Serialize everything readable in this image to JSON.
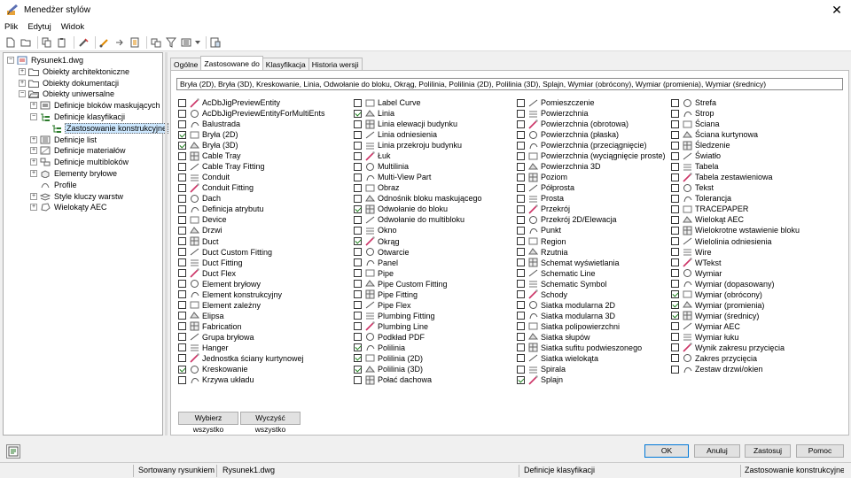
{
  "window": {
    "title": "Menedżer stylów"
  },
  "menu": {
    "file": "Plik",
    "edit": "Edytuj",
    "view": "Widok"
  },
  "tree": {
    "items": [
      {
        "label": "Rysunek1.dwg",
        "level": 0,
        "expander": "−",
        "icon": "drawing-file-icon"
      },
      {
        "label": "Obiekty architektoniczne",
        "level": 1,
        "expander": "+",
        "icon": "folder-icon"
      },
      {
        "label": "Obiekty dokumentacji",
        "level": 1,
        "expander": "+",
        "icon": "folder-icon"
      },
      {
        "label": "Obiekty uniwersalne",
        "level": 1,
        "expander": "−",
        "icon": "folder-open-icon"
      },
      {
        "label": "Definicje bloków maskujących",
        "level": 2,
        "expander": "+",
        "icon": "mask-block-icon"
      },
      {
        "label": "Definicje klasyfikacji",
        "level": 2,
        "expander": "−",
        "icon": "classification-icon"
      },
      {
        "label": "Zastosowanie konstrukcyjne",
        "level": 3,
        "expander": "",
        "icon": "classification-icon",
        "selected": true
      },
      {
        "label": "Definicje list",
        "level": 2,
        "expander": "+",
        "icon": "list-icon"
      },
      {
        "label": "Definicje materiałów",
        "level": 2,
        "expander": "+",
        "icon": "material-icon"
      },
      {
        "label": "Definicje multibloków",
        "level": 2,
        "expander": "+",
        "icon": "multiblock-icon"
      },
      {
        "label": "Elementy bryłowe",
        "level": 2,
        "expander": "+",
        "icon": "mass-element-icon"
      },
      {
        "label": "Profile",
        "level": 2,
        "expander": "",
        "icon": "profile-icon"
      },
      {
        "label": "Style kluczy warstw",
        "level": 2,
        "expander": "+",
        "icon": "layer-key-icon"
      },
      {
        "label": "Wielokąty AEC",
        "level": 2,
        "expander": "+",
        "icon": "polygon-icon"
      }
    ]
  },
  "tabs": [
    {
      "label": "Ogólne",
      "active": false
    },
    {
      "label": "Zastosowane do",
      "active": true
    },
    {
      "label": "Klasyfikacja",
      "active": false
    },
    {
      "label": "Historia wersji",
      "active": false
    }
  ],
  "applies_to_summary": "Bryła (2D), Bryła (3D), Kreskowanie, Linia, Odwołanie do bloku, Okrąg, Polilinia, Polilinia (2D), Polilinia (3D), Splajn, Wymiar (obrócony), Wymiar (promienia), Wymiar (średnicy)",
  "columns": [
    [
      {
        "label": "AcDbJigPreviewEntity",
        "checked": false
      },
      {
        "label": "AcDbJigPreviewEntityForMultiEnts",
        "checked": false
      },
      {
        "label": "Balustrada",
        "checked": false
      },
      {
        "label": "Bryła (2D)",
        "checked": true
      },
      {
        "label": "Bryła (3D)",
        "checked": true
      },
      {
        "label": "Cable Tray",
        "checked": false
      },
      {
        "label": "Cable Tray Fitting",
        "checked": false
      },
      {
        "label": "Conduit",
        "checked": false
      },
      {
        "label": "Conduit Fitting",
        "checked": false
      },
      {
        "label": "Dach",
        "checked": false
      },
      {
        "label": "Definicja atrybutu",
        "checked": false
      },
      {
        "label": "Device",
        "checked": false
      },
      {
        "label": "Drzwi",
        "checked": false
      },
      {
        "label": "Duct",
        "checked": false
      },
      {
        "label": "Duct Custom Fitting",
        "checked": false
      },
      {
        "label": "Duct Fitting",
        "checked": false
      },
      {
        "label": "Duct Flex",
        "checked": false
      },
      {
        "label": "Element bryłowy",
        "checked": false
      },
      {
        "label": "Element konstrukcyjny",
        "checked": false
      },
      {
        "label": "Element zależny",
        "checked": false
      },
      {
        "label": "Elipsa",
        "checked": false
      },
      {
        "label": "Fabrication",
        "checked": false
      },
      {
        "label": "Grupa bryłowa",
        "checked": false
      },
      {
        "label": "Hanger",
        "checked": false
      },
      {
        "label": "Jednostka ściany kurtynowej",
        "checked": false
      },
      {
        "label": "Kreskowanie",
        "checked": true
      },
      {
        "label": "Krzywa układu",
        "checked": false
      }
    ],
    [
      {
        "label": "Label Curve",
        "checked": false
      },
      {
        "label": "Linia",
        "checked": true
      },
      {
        "label": "Linia elewacji budynku",
        "checked": false
      },
      {
        "label": "Linia odniesienia",
        "checked": false
      },
      {
        "label": "Linia przekroju budynku",
        "checked": false
      },
      {
        "label": "Łuk",
        "checked": false
      },
      {
        "label": "Multilinia",
        "checked": false
      },
      {
        "label": "Multi-View Part",
        "checked": false
      },
      {
        "label": "Obraz",
        "checked": false
      },
      {
        "label": "Odnośnik bloku maskującego",
        "checked": false
      },
      {
        "label": "Odwołanie do bloku",
        "checked": true
      },
      {
        "label": "Odwołanie do multibloku",
        "checked": false
      },
      {
        "label": "Okno",
        "checked": false
      },
      {
        "label": "Okrąg",
        "checked": true
      },
      {
        "label": "Otwarcie",
        "checked": false
      },
      {
        "label": "Panel",
        "checked": false
      },
      {
        "label": "Pipe",
        "checked": false
      },
      {
        "label": "Pipe Custom Fitting",
        "checked": false
      },
      {
        "label": "Pipe Fitting",
        "checked": false
      },
      {
        "label": "Pipe Flex",
        "checked": false
      },
      {
        "label": "Plumbing Fitting",
        "checked": false
      },
      {
        "label": "Plumbing Line",
        "checked": false
      },
      {
        "label": "Podkład PDF",
        "checked": false
      },
      {
        "label": "Polilinia",
        "checked": true
      },
      {
        "label": "Polilinia (2D)",
        "checked": true
      },
      {
        "label": "Polilinia (3D)",
        "checked": true
      },
      {
        "label": "Połać dachowa",
        "checked": false
      }
    ],
    [
      {
        "label": "Pomieszczenie",
        "checked": false
      },
      {
        "label": "Powierzchnia",
        "checked": false
      },
      {
        "label": "Powierzchnia (obrotowa)",
        "checked": false
      },
      {
        "label": "Powierzchnia (płaska)",
        "checked": false
      },
      {
        "label": "Powierzchnia (przeciągnięcie)",
        "checked": false
      },
      {
        "label": "Powierzchnia (wyciągnięcie proste)",
        "checked": false
      },
      {
        "label": "Powierzchnia 3D",
        "checked": false
      },
      {
        "label": "Poziom",
        "checked": false
      },
      {
        "label": "Półprosta",
        "checked": false
      },
      {
        "label": "Prosta",
        "checked": false
      },
      {
        "label": "Przekrój",
        "checked": false
      },
      {
        "label": "Przekrój 2D/Elewacja",
        "checked": false
      },
      {
        "label": "Punkt",
        "checked": false
      },
      {
        "label": "Region",
        "checked": false
      },
      {
        "label": "Rzutnia",
        "checked": false
      },
      {
        "label": "Schemat wyświetlania",
        "checked": false
      },
      {
        "label": "Schematic Line",
        "checked": false
      },
      {
        "label": "Schematic Symbol",
        "checked": false
      },
      {
        "label": "Schody",
        "checked": false
      },
      {
        "label": "Siatka modularna 2D",
        "checked": false
      },
      {
        "label": "Siatka modularna 3D",
        "checked": false
      },
      {
        "label": "Siatka polipowierzchni",
        "checked": false
      },
      {
        "label": "Siatka słupów",
        "checked": false
      },
      {
        "label": "Siatka sufitu podwieszonego",
        "checked": false
      },
      {
        "label": "Siatka wielokąta",
        "checked": false
      },
      {
        "label": "Spirala",
        "checked": false
      },
      {
        "label": "Splajn",
        "checked": true
      }
    ],
    [
      {
        "label": "Strefa",
        "checked": false
      },
      {
        "label": "Strop",
        "checked": false
      },
      {
        "label": "Ściana",
        "checked": false
      },
      {
        "label": "Ściana kurtynowa",
        "checked": false
      },
      {
        "label": "Śledzenie",
        "checked": false
      },
      {
        "label": "Światło",
        "checked": false
      },
      {
        "label": "Tabela",
        "checked": false
      },
      {
        "label": "Tabela zestawieniowa",
        "checked": false
      },
      {
        "label": "Tekst",
        "checked": false
      },
      {
        "label": "Tolerancja",
        "checked": false
      },
      {
        "label": "TRACEPAPER",
        "checked": false
      },
      {
        "label": "Wielokąt AEC",
        "checked": false
      },
      {
        "label": "Wielokrotne wstawienie bloku",
        "checked": false
      },
      {
        "label": "Wielolinia odniesienia",
        "checked": false
      },
      {
        "label": "Wire",
        "checked": false
      },
      {
        "label": "WTekst",
        "checked": false
      },
      {
        "label": "Wymiar",
        "checked": false
      },
      {
        "label": "Wymiar (dopasowany)",
        "checked": false
      },
      {
        "label": "Wymiar (obrócony)",
        "checked": true
      },
      {
        "label": "Wymiar (promienia)",
        "checked": true
      },
      {
        "label": "Wymiar (średnicy)",
        "checked": true
      },
      {
        "label": "Wymiar AEC",
        "checked": false
      },
      {
        "label": "Wymiar łuku",
        "checked": false
      },
      {
        "label": "Wynik zakresu przycięcia",
        "checked": false
      },
      {
        "label": "Zakres przycięcia",
        "checked": false
      },
      {
        "label": "Zestaw drzwi/okien",
        "checked": false
      }
    ]
  ],
  "buttons": {
    "select_all": "Wybierz wszystko",
    "clear_all": "Wyczyść wszystko",
    "ok": "OK",
    "cancel": "Anuluj",
    "apply": "Zastosuj",
    "help": "Pomoc"
  },
  "status": {
    "sort": "Sortowany rysunkiem",
    "drawing": "Rysunek1.dwg",
    "category": "Definicje klasyfikacji",
    "style": "Zastosowanie konstrukcyjne"
  },
  "colors": {
    "selection": "#cde8ff",
    "check": "#1a7f1a",
    "default_button_border": "#0078d7"
  }
}
